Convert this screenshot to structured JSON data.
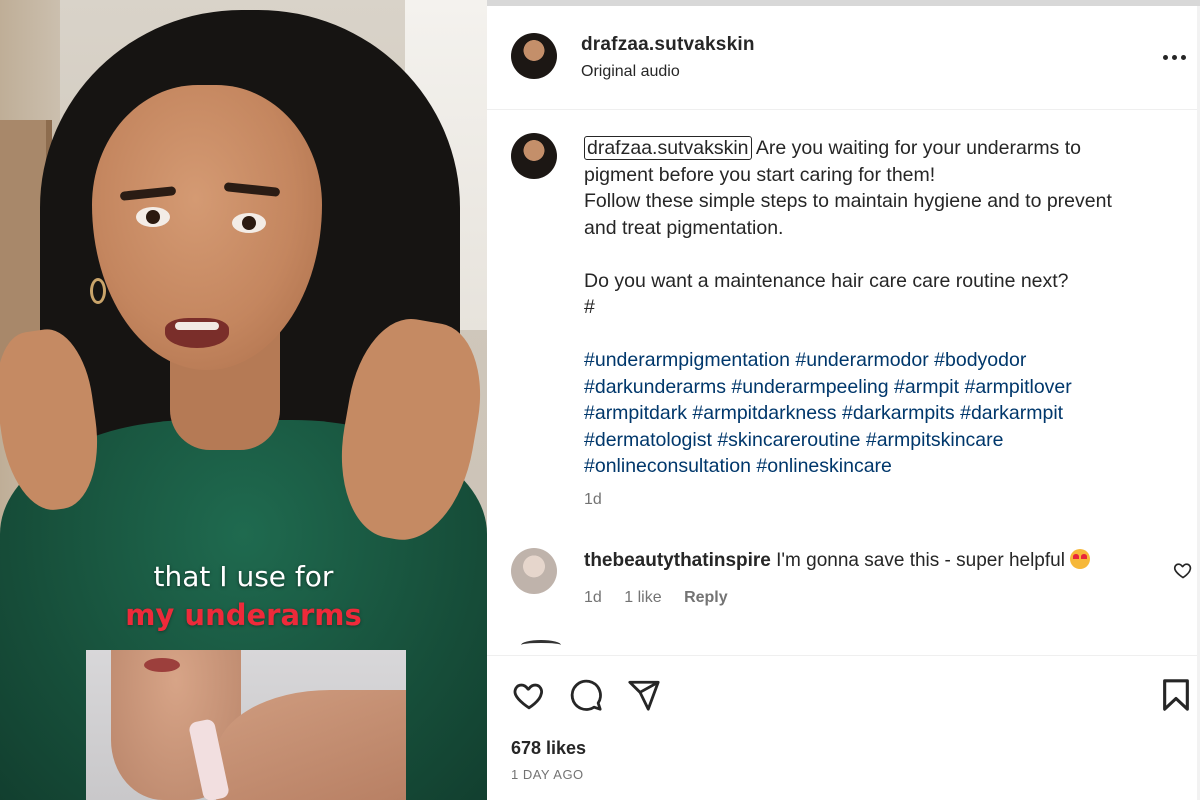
{
  "video": {
    "caption_line1": "that I use for",
    "caption_line2": "my underarms"
  },
  "post_header": {
    "username": "drafzaa.sutvakskin",
    "audio_label": "Original audio",
    "more_icon": "more-horizontal-icon"
  },
  "caption": {
    "username": "drafzaa.sutvakskin",
    "text1": " Are you waiting for your underarms to pigment before you start caring for them!",
    "text2": "Follow these simple steps to maintain hygiene and to prevent and treat pigmentation.",
    "text3": "Do you want a maintenance hair care care routine next?",
    "text4": "#",
    "hashtags": [
      "#underarmpigmentation",
      "#underarmodor",
      "#bodyodor",
      "#darkunderarms",
      "#underarmpeeling",
      "#armpit",
      "#armpitlover",
      "#armpitdark",
      "#armpitdarkness",
      "#darkarmpits",
      "#darkarmpit",
      "#dermatologist",
      "#skincareroutine",
      "#armpitskincare",
      "#onlineconsultation",
      "#onlineskincare"
    ],
    "time": "1d"
  },
  "comment": {
    "username": "thebeautythatinspire",
    "text": " I'm gonna save this - super helpful",
    "time": "1d",
    "likes": "1 like",
    "reply": "Reply"
  },
  "actions": {
    "icons": [
      "heart-icon",
      "comment-icon",
      "share-icon",
      "bookmark-icon"
    ]
  },
  "likes": "678 likes",
  "posted_ago": "1 DAY AGO",
  "colors": {
    "text": "#262626",
    "secondary": "#737373",
    "hashtag": "#00376b",
    "caption_red": "#ee2a3a"
  }
}
